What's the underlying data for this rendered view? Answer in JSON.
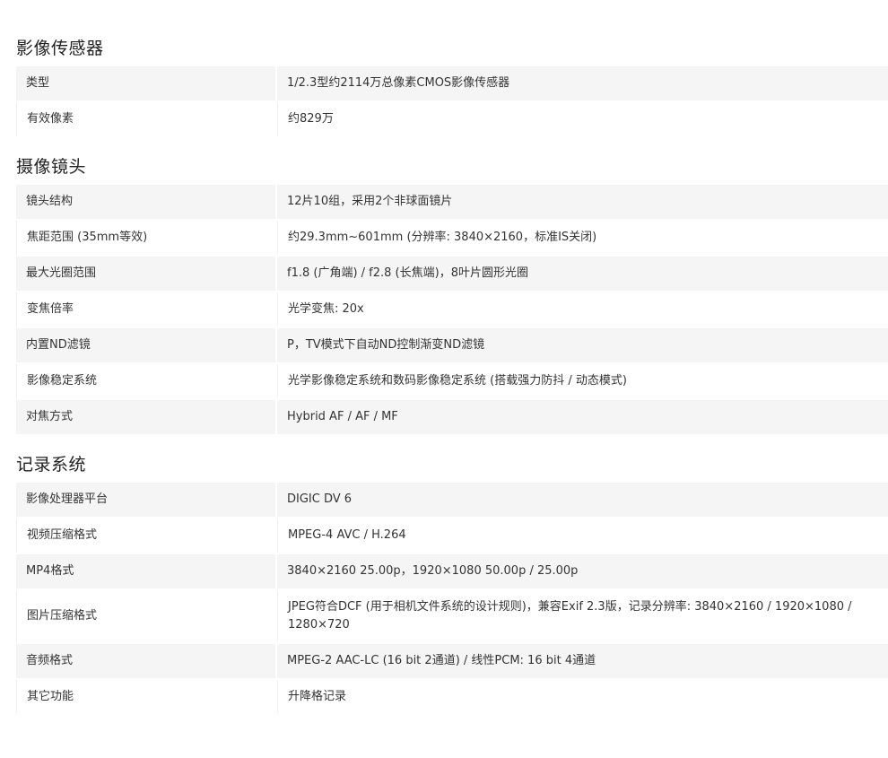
{
  "sections": [
    {
      "title": "影像传感器",
      "rows": [
        {
          "label": "类型",
          "value": "1/2.3型约2114万总像素CMOS影像传感器"
        },
        {
          "label": "有效像素",
          "value": "约829万"
        }
      ]
    },
    {
      "title": "摄像镜头",
      "rows": [
        {
          "label": "镜头结构",
          "value": "12片10组，采用2个非球面镜片"
        },
        {
          "label": "焦距范围 (35mm等效)",
          "value": "约29.3mm~601mm (分辨率: 3840×2160，标准IS关闭)"
        },
        {
          "label": "最大光圈范围",
          "value": "f1.8 (广角端) / f2.8 (长焦端)，8叶片圆形光圈"
        },
        {
          "label": "变焦倍率",
          "value": "光学变焦: 20x"
        },
        {
          "label": "内置ND滤镜",
          "value": "P，TV模式下自动ND控制渐变ND滤镜"
        },
        {
          "label": "影像稳定系统",
          "value": "光学影像稳定系统和数码影像稳定系统 (搭载强力防抖 / 动态模式)"
        },
        {
          "label": "对焦方式",
          "value": "Hybrid AF / AF / MF"
        }
      ]
    },
    {
      "title": "记录系统",
      "rows": [
        {
          "label": "影像处理器平台",
          "value": "DIGIC DV 6"
        },
        {
          "label": "视频压缩格式",
          "value": "MPEG-4 AVC / H.264"
        },
        {
          "label": "MP4格式",
          "value": "3840×2160 25.00p，1920×1080 50.00p / 25.00p"
        },
        {
          "label": "图片压缩格式",
          "value": "JPEG符合DCF (用于相机文件系统的设计规则)，兼容Exif 2.3版，记录分辨率: 3840×2160 / 1920×1080 / 1280×720"
        },
        {
          "label": "音频格式",
          "value": "MPEG-2 AAC-LC (16 bit 2通道) / 线性PCM: 16 bit 4通道"
        },
        {
          "label": "其它功能",
          "value": "升降格记录"
        }
      ]
    }
  ]
}
